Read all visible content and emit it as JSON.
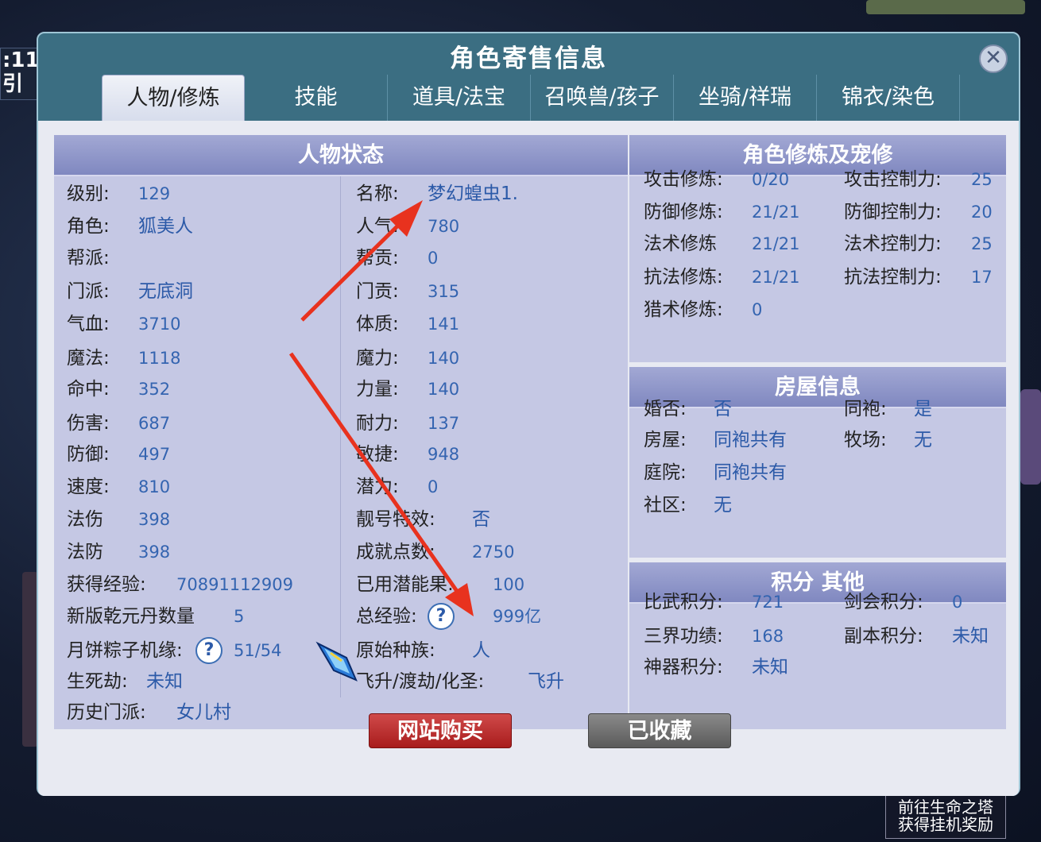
{
  "background": {
    "clock_text": ":11\n引",
    "bottom_right_notice": "前往生命之塔\n获得挂机奖励"
  },
  "dialog": {
    "title": "角色寄售信息",
    "tabs": [
      "人物/修炼",
      "技能",
      "道具/法宝",
      "召唤兽/孩子",
      "坐骑/祥瑞",
      "锦衣/染色"
    ],
    "active_tab": "人物/修炼"
  },
  "status": {
    "header": "人物状态",
    "left": [
      {
        "label": "级别:",
        "value": "129"
      },
      {
        "label": "角色:",
        "value": "狐美人"
      },
      {
        "label": "帮派:",
        "value": ""
      },
      {
        "label": "门派:",
        "value": "无底洞"
      },
      {
        "label": "气血:",
        "value": "3710"
      },
      {
        "label": "魔法:",
        "value": "1118"
      },
      {
        "label": "命中:",
        "value": "352"
      },
      {
        "label": "伤害:",
        "value": "687"
      },
      {
        "label": "防御:",
        "value": "497"
      },
      {
        "label": "速度:",
        "value": "810"
      },
      {
        "label": "法伤",
        "value": "398"
      },
      {
        "label": "法防",
        "value": "398"
      },
      {
        "label": "获得经验:",
        "value": "70891112909"
      },
      {
        "label": "新版乾元丹数量",
        "value": "5"
      },
      {
        "label": "月饼粽子机缘:",
        "value": "51/54"
      },
      {
        "label": "生死劫:",
        "value": "未知"
      },
      {
        "label": "历史门派:",
        "value": "女儿村"
      }
    ],
    "right": [
      {
        "label": "名称:",
        "value": "梦幻蝗虫1."
      },
      {
        "label": "人气:",
        "value": "780"
      },
      {
        "label": "帮贡:",
        "value": "0"
      },
      {
        "label": "门贡:",
        "value": "315"
      },
      {
        "label": "体质:",
        "value": "141"
      },
      {
        "label": "魔力:",
        "value": "140"
      },
      {
        "label": "力量:",
        "value": "140"
      },
      {
        "label": "耐力:",
        "value": "137"
      },
      {
        "label": "敏捷:",
        "value": "948"
      },
      {
        "label": "潜力:",
        "value": "0"
      },
      {
        "label": "靓号特效:",
        "value": "否"
      },
      {
        "label": "成就点数:",
        "value": "2750"
      },
      {
        "label": "已用潜能果:",
        "value": "100"
      },
      {
        "label": "总经验:",
        "value": "999亿"
      },
      {
        "label": "原始种族:",
        "value": "人"
      },
      {
        "label": "飞升/渡劫/化圣:",
        "value": "飞升"
      }
    ],
    "help_glyph": "?"
  },
  "cultivation": {
    "header": "角色修炼及宠修",
    "rows": [
      {
        "l1": "攻击修炼:",
        "v1": "0/20",
        "l2": "攻击控制力:",
        "v2": "25"
      },
      {
        "l1": "防御修炼:",
        "v1": "21/21",
        "l2": "防御控制力:",
        "v2": "20"
      },
      {
        "l1": "法术修炼",
        "v1": "21/21",
        "l2": "法术控制力:",
        "v2": "25"
      },
      {
        "l1": "抗法修炼:",
        "v1": "21/21",
        "l2": "抗法控制力:",
        "v2": "17"
      },
      {
        "l1": "猎术修炼:",
        "v1": "0",
        "l2": "",
        "v2": ""
      }
    ]
  },
  "house": {
    "header": "房屋信息",
    "rows": [
      {
        "l1": "婚否:",
        "v1": "否",
        "l2": "同袍:",
        "v2": "是"
      },
      {
        "l1": "房屋:",
        "v1": "同袍共有",
        "l2": "牧场:",
        "v2": "无"
      },
      {
        "l1": "庭院:",
        "v1": "同袍共有",
        "l2": "",
        "v2": ""
      },
      {
        "l1": "社区:",
        "v1": "无",
        "l2": "",
        "v2": ""
      }
    ]
  },
  "points": {
    "header": "积分 其他",
    "rows": [
      {
        "l1": "比武积分:",
        "v1": "721",
        "l2": "剑会积分:",
        "v2": "0"
      },
      {
        "l1": "三界功绩:",
        "v1": "168",
        "l2": "副本积分:",
        "v2": "未知"
      },
      {
        "l1": "神器积分:",
        "v1": "未知",
        "l2": "",
        "v2": ""
      }
    ]
  },
  "buttons": {
    "buy": "网站购买",
    "favorite": "已收藏"
  },
  "colors": {
    "frame": "#3b6e82",
    "panel": "#c5c8e4",
    "value_text": "#2c5aa8",
    "arrow": "#e8321e",
    "buy_button": "#c03030"
  }
}
